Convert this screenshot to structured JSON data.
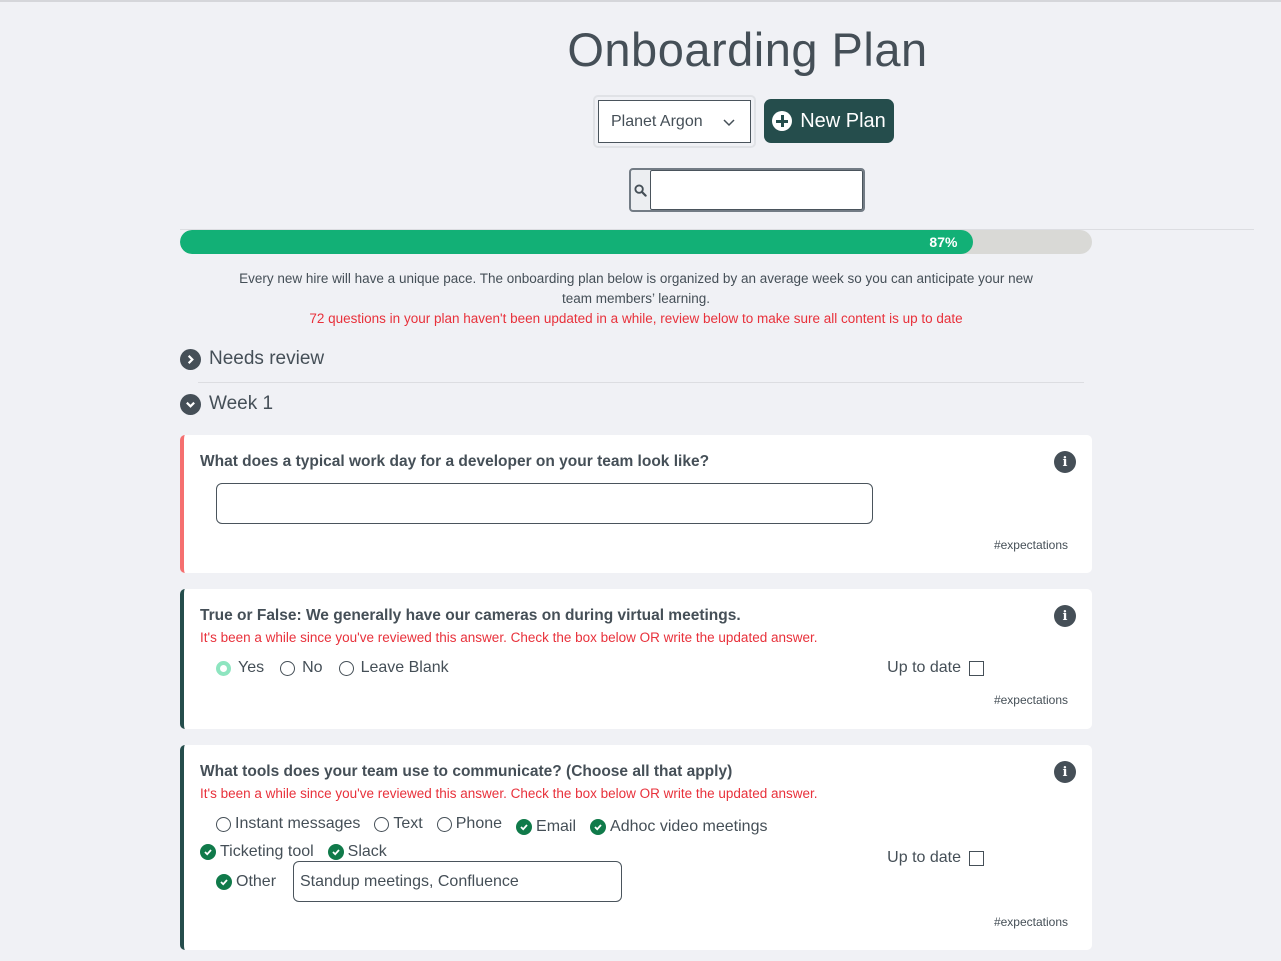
{
  "header": {
    "title": "Onboarding Plan",
    "company_select": "Planet Argon",
    "new_plan_label": "New Plan",
    "search_value": ""
  },
  "progress": {
    "percent": 87,
    "label": "87%"
  },
  "intro": {
    "line1": "Every new hire will have a unique pace. The onboarding plan below is organized by an average week so you can anticipate your new",
    "line2": "team members’ learning.",
    "warning": "72 questions in your plan haven't been updated in a while, review below to make sure all content is up to date"
  },
  "sections": [
    {
      "label": "Needs review",
      "expanded": false
    },
    {
      "label": "Week 1",
      "expanded": true
    }
  ],
  "questions": [
    {
      "question": "What does a typical work day for a developer on your team look like?",
      "answer": "",
      "tag": "#expectations"
    },
    {
      "question": "True or False: We generally have our cameras on during virtual meetings.",
      "stale_warning": "It's been a while since you've reviewed this answer. Check the box below OR write the updated answer.",
      "options": [
        {
          "label": "Yes",
          "checked": true
        },
        {
          "label": "No",
          "checked": false
        },
        {
          "label": "Leave Blank",
          "checked": false
        }
      ],
      "up_to_date_label": "Up to date",
      "up_to_date": false,
      "tag": "#expectations"
    },
    {
      "question": "What tools does your team use to communicate? (Choose all that apply)",
      "stale_warning": "It's been a while since you've reviewed this answer. Check the box below OR write the updated answer.",
      "options": [
        {
          "label": "Instant messages",
          "checked": false
        },
        {
          "label": "Text",
          "checked": false
        },
        {
          "label": "Phone",
          "checked": false
        },
        {
          "label": "Email",
          "checked": true
        },
        {
          "label": "Adhoc video meetings",
          "checked": true
        },
        {
          "label": "Ticketing tool",
          "checked": true
        },
        {
          "label": "Slack",
          "checked": true
        }
      ],
      "other_label": "Other",
      "other_checked": true,
      "other_value": "Standup meetings, Confluence",
      "up_to_date_label": "Up to date",
      "up_to_date": false,
      "tag": "#expectations"
    }
  ],
  "colors": {
    "accent": "#254d4c",
    "progress": "#12b076",
    "warning": "#e8313b",
    "alert_border": "#f56f6f"
  }
}
